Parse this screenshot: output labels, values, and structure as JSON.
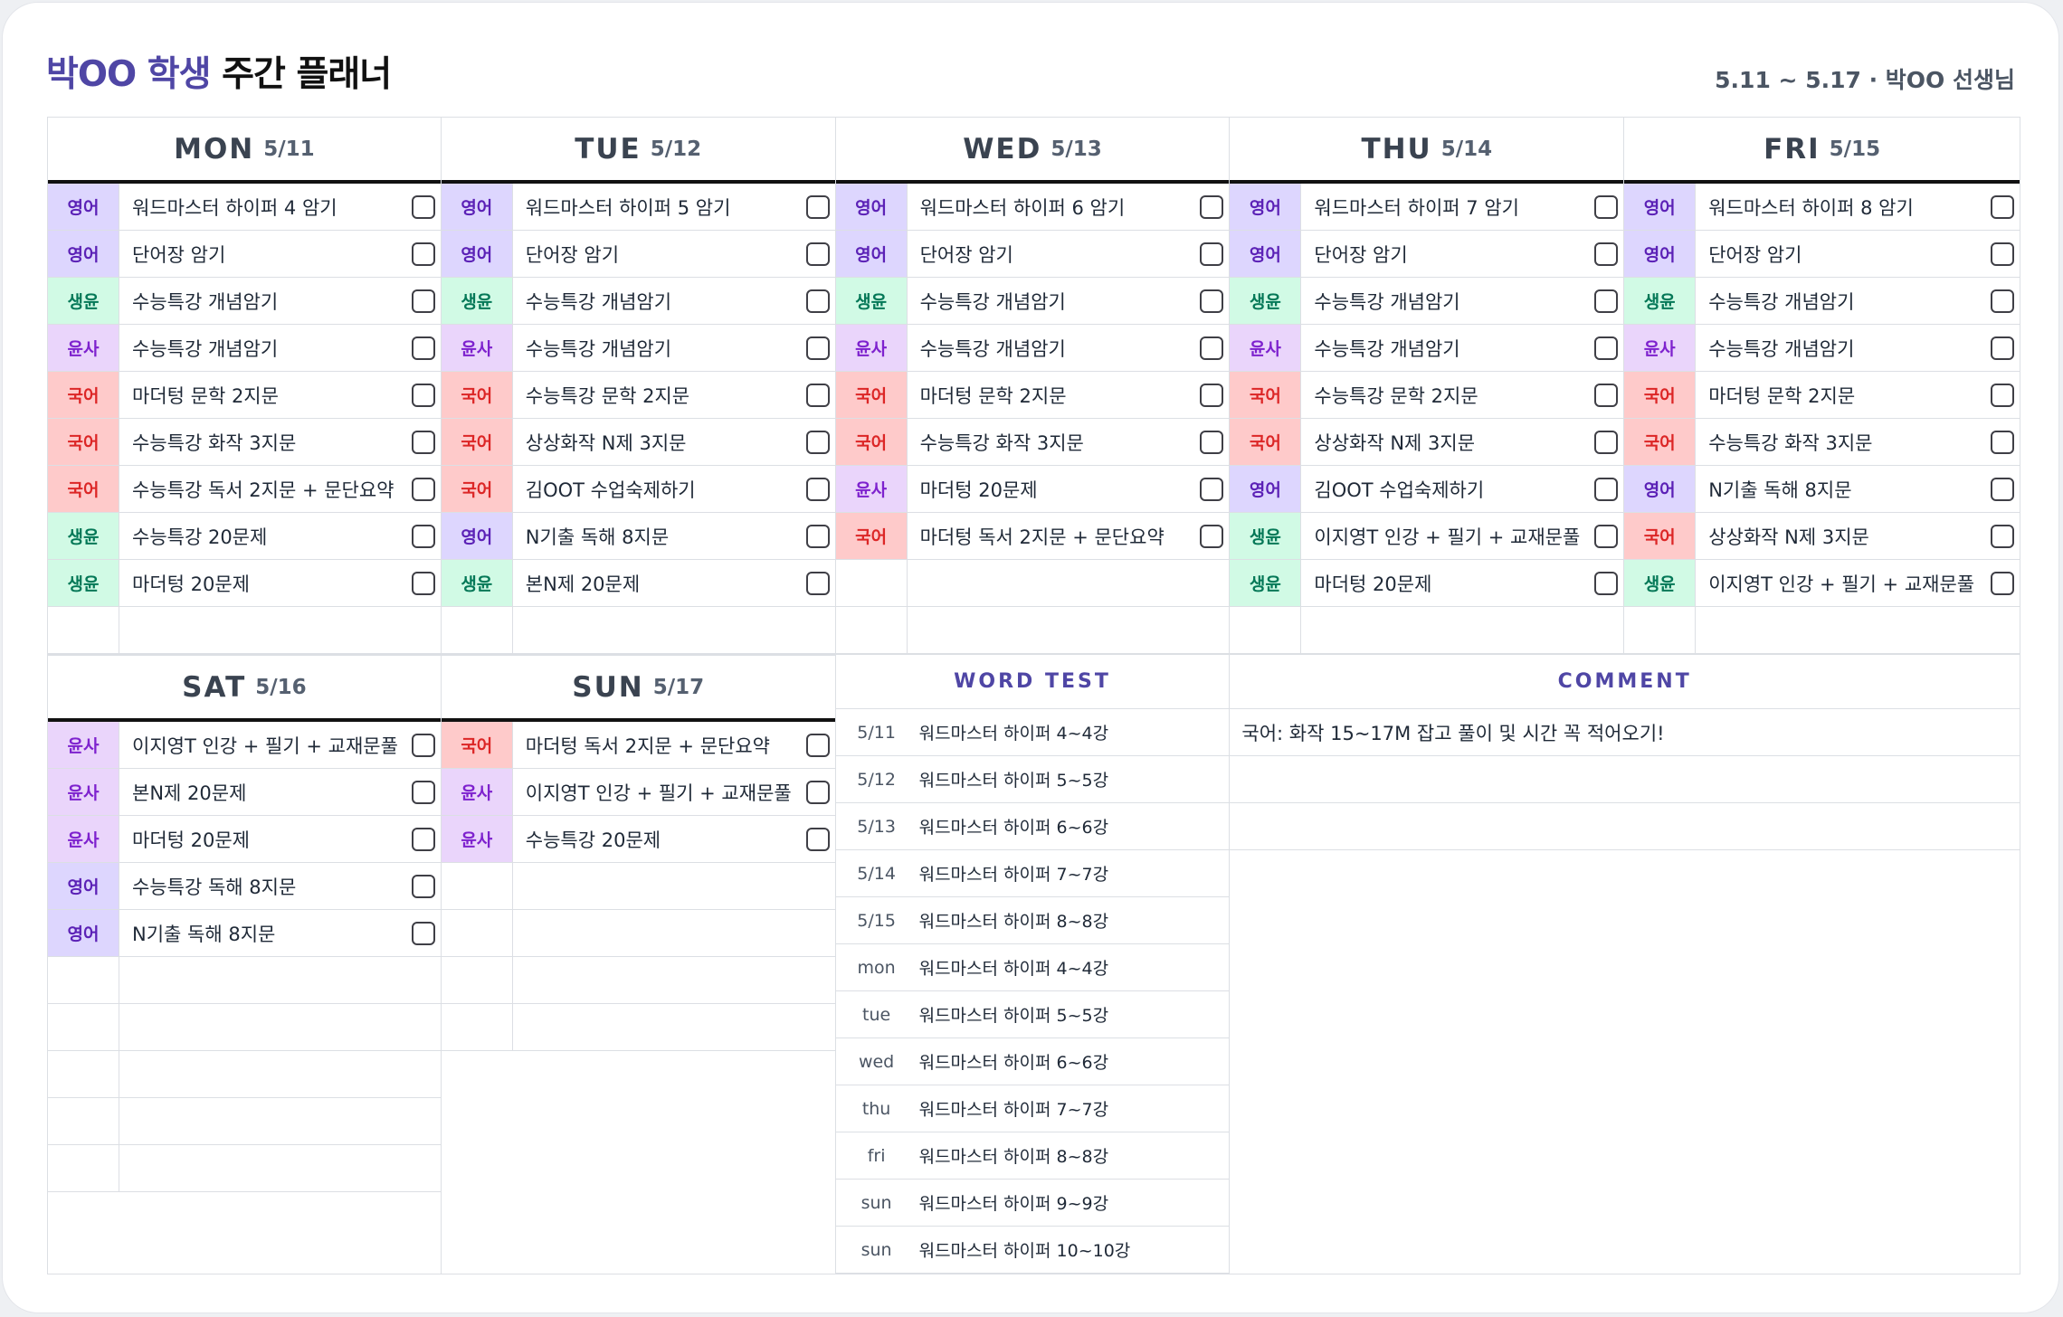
{
  "header": {
    "student_name": "박OO 학생",
    "planner_label": "주간 플래너",
    "meta": "5.11 ~ 5.17 · 박OO 선생님"
  },
  "days": [
    {
      "name": "MON",
      "date": "5/11",
      "tasks": [
        {
          "subject": "영어",
          "cls": "s-eng",
          "text": "워드마스터 하이퍼 4 암기"
        },
        {
          "subject": "영어",
          "cls": "s-eng",
          "text": "단어장 암기"
        },
        {
          "subject": "생윤",
          "cls": "s-bio",
          "text": "수능특강 개념암기"
        },
        {
          "subject": "윤사",
          "cls": "s-hist",
          "text": "수능특강 개념암기"
        },
        {
          "subject": "국어",
          "cls": "s-kor",
          "text": "마더텅 문학 2지문"
        },
        {
          "subject": "국어",
          "cls": "s-kor",
          "text": "수능특강 화작 3지문"
        },
        {
          "subject": "국어",
          "cls": "s-kor",
          "text": "수능특강 독서 2지문 + 문단요약"
        },
        {
          "subject": "생윤",
          "cls": "s-bio",
          "text": "수능특강 20문제"
        },
        {
          "subject": "생윤",
          "cls": "s-bio",
          "text": "마더텅 20문제"
        }
      ]
    },
    {
      "name": "TUE",
      "date": "5/12",
      "tasks": [
        {
          "subject": "영어",
          "cls": "s-eng",
          "text": "워드마스터 하이퍼 5 암기"
        },
        {
          "subject": "영어",
          "cls": "s-eng",
          "text": "단어장 암기"
        },
        {
          "subject": "생윤",
          "cls": "s-bio",
          "text": "수능특강 개념암기"
        },
        {
          "subject": "윤사",
          "cls": "s-hist",
          "text": "수능특강 개념암기"
        },
        {
          "subject": "국어",
          "cls": "s-kor",
          "text": "수능특강 문학 2지문"
        },
        {
          "subject": "국어",
          "cls": "s-kor",
          "text": "상상화작 N제 3지문"
        },
        {
          "subject": "국어",
          "cls": "s-kor",
          "text": "김OOT 수업숙제하기"
        },
        {
          "subject": "영어",
          "cls": "s-eng",
          "text": "N기출 독해 8지문"
        },
        {
          "subject": "생윤",
          "cls": "s-bio",
          "text": "본N제 20문제"
        }
      ]
    },
    {
      "name": "WED",
      "date": "5/13",
      "tasks": [
        {
          "subject": "영어",
          "cls": "s-eng",
          "text": "워드마스터 하이퍼 6 암기"
        },
        {
          "subject": "영어",
          "cls": "s-eng",
          "text": "단어장 암기"
        },
        {
          "subject": "생윤",
          "cls": "s-bio",
          "text": "수능특강 개념암기"
        },
        {
          "subject": "윤사",
          "cls": "s-hist",
          "text": "수능특강 개념암기"
        },
        {
          "subject": "국어",
          "cls": "s-kor",
          "text": "마더텅 문학 2지문"
        },
        {
          "subject": "국어",
          "cls": "s-kor",
          "text": "수능특강 화작 3지문"
        },
        {
          "subject": "윤사",
          "cls": "s-hist",
          "text": "마더텅 20문제"
        },
        {
          "subject": "국어",
          "cls": "s-kor",
          "text": "마더텅 독서 2지문 + 문단요약"
        }
      ]
    },
    {
      "name": "THU",
      "date": "5/14",
      "tasks": [
        {
          "subject": "영어",
          "cls": "s-eng",
          "text": "워드마스터 하이퍼 7 암기"
        },
        {
          "subject": "영어",
          "cls": "s-eng",
          "text": "단어장 암기"
        },
        {
          "subject": "생윤",
          "cls": "s-bio",
          "text": "수능특강 개념암기"
        },
        {
          "subject": "윤사",
          "cls": "s-hist",
          "text": "수능특강 개념암기"
        },
        {
          "subject": "국어",
          "cls": "s-kor",
          "text": "수능특강 문학 2지문"
        },
        {
          "subject": "국어",
          "cls": "s-kor",
          "text": "상상화작 N제 3지문"
        },
        {
          "subject": "영어",
          "cls": "s-eng",
          "text": "김OOT 수업숙제하기"
        },
        {
          "subject": "생윤",
          "cls": "s-bio",
          "text": "이지영T 인강 + 필기 + 교재문풀"
        },
        {
          "subject": "생윤",
          "cls": "s-bio",
          "text": "마더텅 20문제"
        }
      ]
    },
    {
      "name": "FRI",
      "date": "5/15",
      "tasks": [
        {
          "subject": "영어",
          "cls": "s-eng",
          "text": "워드마스터 하이퍼 8 암기"
        },
        {
          "subject": "영어",
          "cls": "s-eng",
          "text": "단어장 암기"
        },
        {
          "subject": "생윤",
          "cls": "s-bio",
          "text": "수능특강 개념암기"
        },
        {
          "subject": "윤사",
          "cls": "s-hist",
          "text": "수능특강 개념암기"
        },
        {
          "subject": "국어",
          "cls": "s-kor",
          "text": "마더텅 문학 2지문"
        },
        {
          "subject": "국어",
          "cls": "s-kor",
          "text": "수능특강 화작 3지문"
        },
        {
          "subject": "영어",
          "cls": "s-eng",
          "text": "N기출 독해 8지문"
        },
        {
          "subject": "국어",
          "cls": "s-kor",
          "text": "상상화작 N제 3지문"
        },
        {
          "subject": "생윤",
          "cls": "s-bio",
          "text": "이지영T 인강 + 필기 + 교재문풀"
        }
      ]
    },
    {
      "name": "SAT",
      "date": "5/16",
      "tasks": [
        {
          "subject": "윤사",
          "cls": "s-hist",
          "text": "이지영T 인강 + 필기 + 교재문풀"
        },
        {
          "subject": "윤사",
          "cls": "s-hist",
          "text": "본N제 20문제"
        },
        {
          "subject": "윤사",
          "cls": "s-hist",
          "text": "마더텅 20문제"
        },
        {
          "subject": "영어",
          "cls": "s-eng",
          "text": "수능특강 독해 8지문"
        },
        {
          "subject": "영어",
          "cls": "s-eng",
          "text": "N기출 독해 8지문"
        }
      ]
    },
    {
      "name": "SUN",
      "date": "5/17",
      "tasks": [
        {
          "subject": "국어",
          "cls": "s-kor",
          "text": "마더텅 독서 2지문 + 문단요약"
        },
        {
          "subject": "윤사",
          "cls": "s-hist",
          "text": "이지영T 인강 + 필기 + 교재문풀"
        },
        {
          "subject": "윤사",
          "cls": "s-hist",
          "text": "수능특강 20문제"
        }
      ]
    }
  ],
  "word_test": {
    "title": "WORD TEST",
    "rows": [
      {
        "label": "5/11",
        "value": "워드마스터 하이퍼 4~4강"
      },
      {
        "label": "5/12",
        "value": "워드마스터 하이퍼 5~5강"
      },
      {
        "label": "5/13",
        "value": "워드마스터 하이퍼 6~6강"
      },
      {
        "label": "5/14",
        "value": "워드마스터 하이퍼 7~7강"
      },
      {
        "label": "5/15",
        "value": "워드마스터 하이퍼 8~8강"
      },
      {
        "label": "mon",
        "value": "워드마스터 하이퍼 4~4강"
      },
      {
        "label": "tue",
        "value": "워드마스터 하이퍼 5~5강"
      },
      {
        "label": "wed",
        "value": "워드마스터 하이퍼 6~6강"
      },
      {
        "label": "thu",
        "value": "워드마스터 하이퍼 7~7강"
      },
      {
        "label": "fri",
        "value": "워드마스터 하이퍼 8~8강"
      },
      {
        "label": "sun",
        "value": "워드마스터 하이퍼 9~9강"
      },
      {
        "label": "sun",
        "value": "워드마스터 하이퍼 10~10강"
      }
    ]
  },
  "comment": {
    "title": "COMMENT",
    "lines": [
      "국어: 화작 15~17M 잡고 풀이 및 시간 꼭 적어오기!",
      "",
      ""
    ]
  }
}
